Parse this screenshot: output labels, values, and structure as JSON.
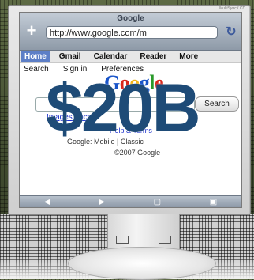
{
  "browser": {
    "title": "Google",
    "url": "http://www.google.com/m",
    "tabs": [
      {
        "label": "Home",
        "active": true
      },
      {
        "label": "Gmail",
        "active": false
      },
      {
        "label": "Calendar",
        "active": false
      },
      {
        "label": "Reader",
        "active": false
      },
      {
        "label": "More",
        "active": false
      }
    ],
    "subnav": [
      "Search",
      "Sign in",
      "Preferences"
    ],
    "search_button": "Search",
    "links_line": "Images  Local",
    "help_line": "Help & Terms",
    "footer_line": "Google: Mobile | Classic",
    "copyright": "©2007 Google"
  },
  "monitor_brand": "MultiSync LCD",
  "logo": {
    "letters": [
      {
        "ch": "G",
        "color": "#1a55c9"
      },
      {
        "ch": "o",
        "color": "#d8261a"
      },
      {
        "ch": "o",
        "color": "#f1b314"
      },
      {
        "ch": "g",
        "color": "#1a55c9"
      },
      {
        "ch": "l",
        "color": "#2a9a2a"
      },
      {
        "ch": "e",
        "color": "#d8261a"
      }
    ]
  },
  "overlay_text": "$20B",
  "colors": {
    "overlay": "#1e4b77",
    "active_tab": "#5d7fc7",
    "link": "#1a2fcc"
  }
}
